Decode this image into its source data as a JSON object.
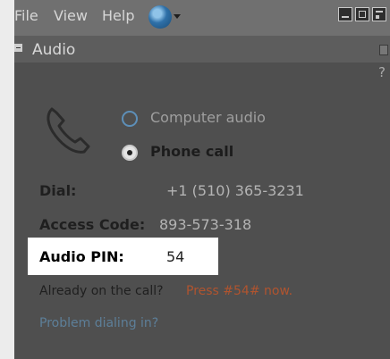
{
  "menu": {
    "file": "File",
    "view": "View",
    "help": "Help"
  },
  "icons": {
    "globe": "globe-icon",
    "phone": "phone-handset-icon"
  },
  "section": {
    "title": "Audio",
    "help_mark": "?"
  },
  "audio_mode": {
    "options": [
      {
        "label": "Computer audio",
        "selected": false
      },
      {
        "label": "Phone call",
        "selected": true
      }
    ]
  },
  "dial": {
    "label": "Dial:",
    "value": "+1 (510) 365-3231"
  },
  "access_code": {
    "label": "Access Code:",
    "value": "893-573-318"
  },
  "audio_pin": {
    "label": "Audio PIN:",
    "value": "54"
  },
  "already_on_call": {
    "text": "Already on the call?",
    "action": "Press #54# now."
  },
  "problem_link": "Problem dialing in?",
  "colors": {
    "window_bg": "#4f4f4f",
    "menubar_bg": "#707070",
    "link_blue": "#5d7f99",
    "accent_orange": "#b0542f",
    "highlight": "#ffffff"
  }
}
